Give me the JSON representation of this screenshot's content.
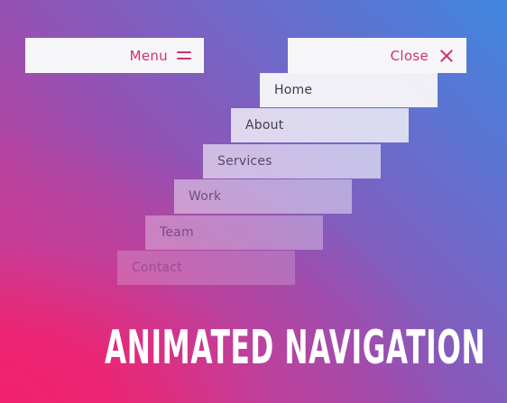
{
  "header": {
    "menu_label": "Menu",
    "close_label": "Close"
  },
  "nav": {
    "items": [
      {
        "label": "Home"
      },
      {
        "label": "About"
      },
      {
        "label": "Services"
      },
      {
        "label": "Work"
      },
      {
        "label": "Team"
      },
      {
        "label": "Contact"
      }
    ]
  },
  "headline": "ANIMATED NAVIGATION",
  "colors": {
    "accent": "#d0306f",
    "button_bg": "#f6f6f8",
    "gradient_top_right": "#3f86df",
    "gradient_bottom_left": "#f0226e"
  },
  "icons": {
    "menu": "hamburger-icon",
    "close": "close-icon"
  }
}
